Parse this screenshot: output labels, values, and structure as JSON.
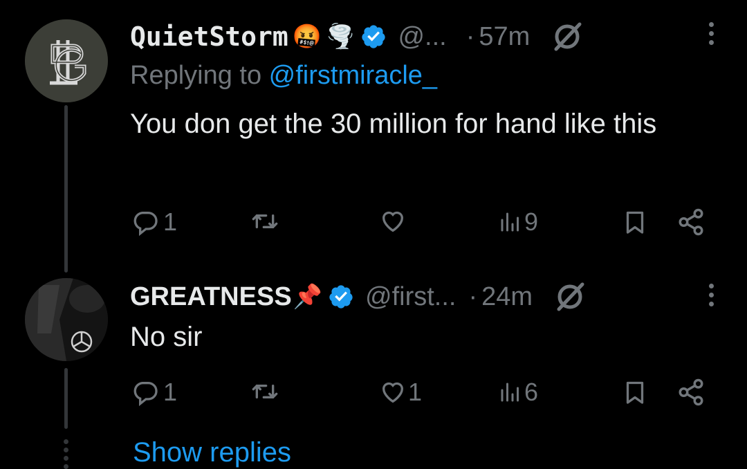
{
  "tweets": [
    {
      "display_name": "QuietStorm",
      "handle": "@...",
      "time": "57m",
      "dot": "·",
      "replying_label": "Replying to ",
      "replying_mention": "@firstmiracle_",
      "text": "You don get the 30 million for hand like this",
      "replies": "1",
      "retweets": "",
      "likes": "",
      "views": "9",
      "emoji_1": "🤬",
      "emoji_2": "🌪️"
    },
    {
      "display_name": "GREATNESS",
      "handle": "@first...",
      "time": "24m",
      "dot": "·",
      "text": "No sir",
      "replies": "1",
      "retweets": "",
      "likes": "1",
      "views": "6",
      "emoji_1": "📌"
    }
  ],
  "show_replies": "Show replies",
  "colors": {
    "background": "#000000",
    "text": "#e7e9ea",
    "muted": "#71767b",
    "link": "#1d9bf0",
    "verified": "#1d9bf0"
  },
  "icons": [
    "reply-icon",
    "retweet-icon",
    "like-icon",
    "views-icon",
    "bookmark-icon",
    "share-icon",
    "mute-icon",
    "more-icon",
    "verified-badge-icon"
  ]
}
